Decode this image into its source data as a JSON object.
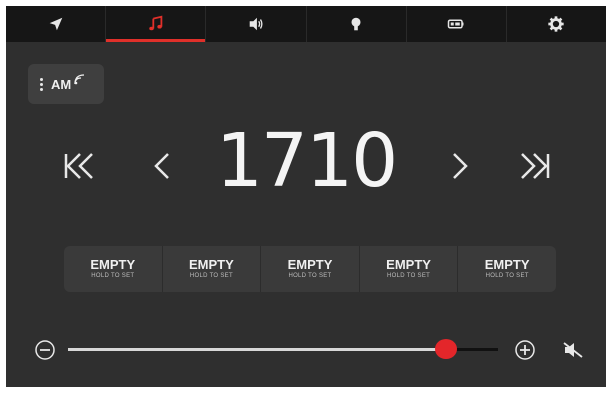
{
  "tabs": [
    {
      "id": "navigation",
      "icon": "navigation-arrow-icon",
      "active": false
    },
    {
      "id": "media",
      "icon": "music-note-icon",
      "active": true
    },
    {
      "id": "audio",
      "icon": "speaker-icon",
      "active": false
    },
    {
      "id": "lighting",
      "icon": "lightbulb-icon",
      "active": false
    },
    {
      "id": "phone",
      "icon": "battery-icon",
      "active": false
    },
    {
      "id": "settings",
      "icon": "gear-icon",
      "active": false
    }
  ],
  "source": {
    "label": "AM",
    "icon": "broadcast-icon"
  },
  "tuner": {
    "frequency": "1710",
    "seek_back_icon": "seek-back-icon",
    "tune_down_icon": "chevron-left-icon",
    "tune_up_icon": "chevron-right-icon",
    "seek_forward_icon": "seek-forward-icon"
  },
  "presets": [
    {
      "title": "EMPTY",
      "subtitle": "HOLD TO SET"
    },
    {
      "title": "EMPTY",
      "subtitle": "HOLD TO SET"
    },
    {
      "title": "EMPTY",
      "subtitle": "HOLD TO SET"
    },
    {
      "title": "EMPTY",
      "subtitle": "HOLD TO SET"
    },
    {
      "title": "EMPTY",
      "subtitle": "HOLD TO SET"
    }
  ],
  "volume": {
    "level": 0.88,
    "minus_icon": "minus-circle-icon",
    "plus_icon": "plus-circle-icon",
    "mute_icon": "mute-icon"
  },
  "colors": {
    "accent": "#e0302a",
    "background": "#2f2f2f",
    "topbar": "#161616",
    "text": "#f4f4f4"
  }
}
